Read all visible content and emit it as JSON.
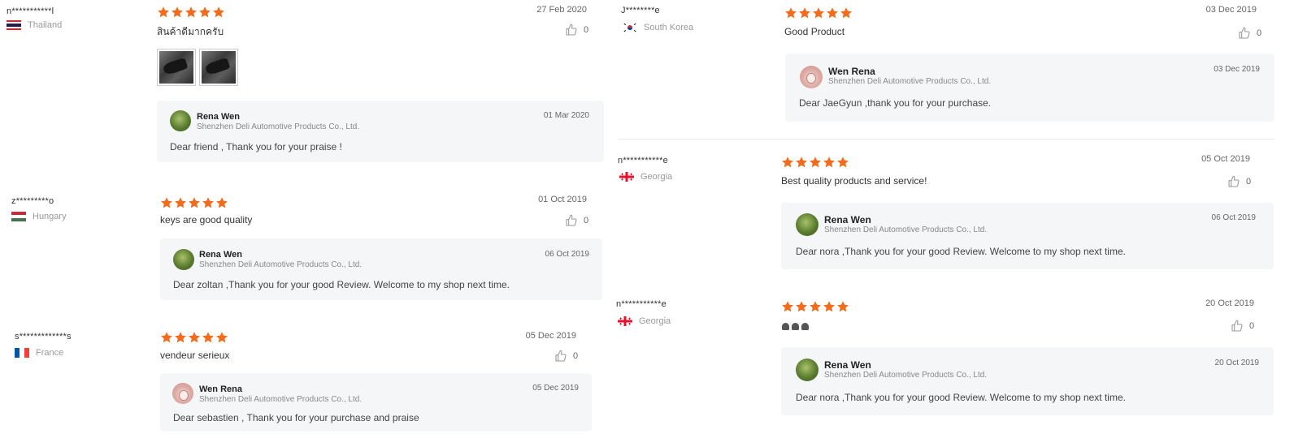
{
  "colors": {
    "star": "#f26c1d",
    "reply_bg": "#f5f6f7"
  },
  "reviews": [
    {
      "user": "n***********l",
      "country": "Thailand",
      "flag": "thailand-flag",
      "stars": 5,
      "date": "27 Feb 2020",
      "text": "สินค้าดีมากครับ",
      "likes": "0",
      "images": [
        "car-key-photo-1",
        "car-key-photo-2"
      ],
      "reply": {
        "name": "Rena Wen",
        "shop": "Shenzhen Deli Automotive Products Co., Ltd.",
        "date": "01 Mar 2020",
        "message": "Dear friend , Thank you for your praise !"
      }
    },
    {
      "user": "z*********o",
      "country": "Hungary",
      "flag": "hungary-flag",
      "stars": 5,
      "date": "01 Oct 2019",
      "text": "keys are good quality",
      "likes": "0",
      "reply": {
        "name": "Rena Wen",
        "shop": "Shenzhen Deli Automotive Products Co., Ltd.",
        "date": "06 Oct 2019",
        "message": "Dear zoltan ,Thank you for your good Review. Welcome to my shop next time."
      }
    },
    {
      "user": "s*************s",
      "country": "France",
      "flag": "france-flag",
      "stars": 5,
      "date": "05 Dec 2019",
      "text": "vendeur serieux",
      "likes": "0",
      "reply": {
        "name": "Wen Rena",
        "shop": "Shenzhen Deli Automotive Products Co., Ltd.",
        "date": "05 Dec 2019",
        "message": "Dear sebastien , Thank you for your purchase and praise"
      }
    },
    {
      "user": "J********e",
      "country": "South Korea",
      "flag": "south-korea-flag",
      "stars": 5,
      "date": "03 Dec 2019",
      "text": "Good Product",
      "likes": "0",
      "reply": {
        "name": "Wen Rena",
        "shop": "Shenzhen Deli Automotive Products Co., Ltd.",
        "date": "03 Dec 2019",
        "message": "Dear JaeGyun ,thank you for your purchase."
      }
    },
    {
      "user": "n***********e",
      "country": "Georgia",
      "flag": "georgia-flag",
      "stars": 5,
      "date": "05 Oct 2019",
      "text": "Best quality products and service!",
      "likes": "0",
      "reply": {
        "name": "Rena Wen",
        "shop": "Shenzhen Deli Automotive Products Co., Ltd.",
        "date": "06 Oct 2019",
        "message": "Dear nora  ,Thank you for your good Review. Welcome to my shop next time."
      }
    },
    {
      "user": "n***********e",
      "country": "Georgia",
      "flag": "georgia-flag",
      "stars": 5,
      "date": "20 Oct 2019",
      "text": "",
      "emoji": "thumbs-up-emoji",
      "likes": "0",
      "reply": {
        "name": "Rena Wen",
        "shop": "Shenzhen Deli Automotive Products Co., Ltd.",
        "date": "20 Oct 2019",
        "message": "Dear nora  ,Thank you for your good Review. Welcome to my shop next time."
      }
    }
  ]
}
